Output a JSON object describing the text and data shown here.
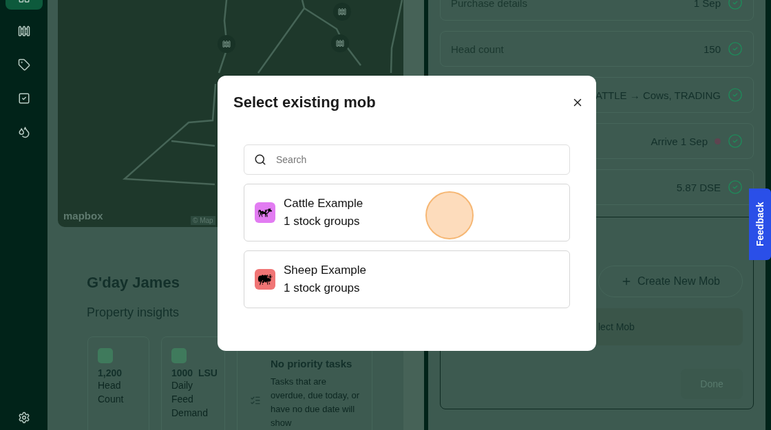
{
  "sidebar": {
    "items": [
      {
        "kind": "home",
        "selected": true
      },
      {
        "kind": "fence",
        "selected": false
      },
      {
        "kind": "tag",
        "selected": false
      },
      {
        "kind": "task",
        "selected": false
      },
      {
        "kind": "drops",
        "selected": false
      }
    ],
    "settings": {
      "kind": "settings"
    }
  },
  "map": {
    "logo": "mapbox",
    "attribution": "© Map"
  },
  "greeting": "G'day James",
  "insights_title": "Property insights",
  "insights": [
    {
      "value": "1,200",
      "label": "Head Count"
    },
    {
      "value": "1000",
      "unit": "LSU",
      "label": "Daily Feed Demand"
    }
  ],
  "tasks": {
    "title": "No priority tasks",
    "text": "Tasks that are overdue, due today, or have no due date will show"
  },
  "details": [
    {
      "label": "Purchase details",
      "value": "1 Sep",
      "done": true,
      "flagged": false
    },
    {
      "label": "Head count",
      "value": "150",
      "done": true,
      "flagged": false
    },
    {
      "value": "ATTLE → Cows, TRADING",
      "done": true,
      "flagged": false
    },
    {
      "value": "Arrive 1 Sep",
      "done": true,
      "flagged": true
    },
    {
      "value": "5.87 DSE",
      "done": true,
      "flagged": false
    }
  ],
  "mob_actions": {
    "create": "Create New Mob",
    "select": "lect Mob",
    "done": {
      "label": "Done",
      "disabled": true
    }
  },
  "feedback": "Feedback",
  "modal": {
    "title": "Select existing mob",
    "search": {
      "placeholder": "Search"
    },
    "mobs": [
      {
        "kind": "cattle",
        "name": "Cattle Example",
        "groups": "1 stock groups",
        "color": "#e27cf2"
      },
      {
        "kind": "sheep",
        "name": "Sheep Example",
        "groups": "1 stock groups",
        "color": "#f07575"
      }
    ]
  }
}
